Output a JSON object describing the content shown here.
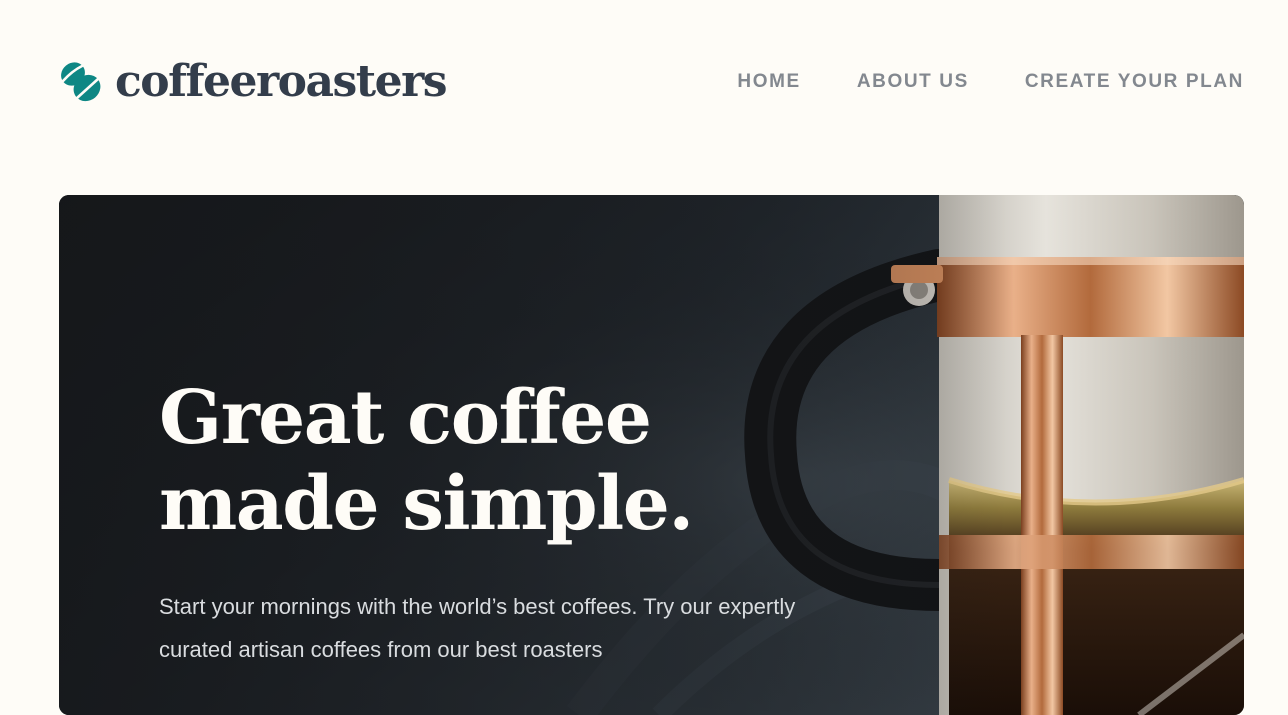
{
  "brand": {
    "logo_text": "coffeeroasters",
    "logo_icon": "coffee-beans-icon",
    "accent_color": "#0E8784",
    "dark_color": "#333D4B"
  },
  "nav": {
    "items": [
      {
        "label": "HOME"
      },
      {
        "label": "ABOUT US"
      },
      {
        "label": "CREATE YOUR PLAN"
      }
    ]
  },
  "hero": {
    "title_line1": "Great coffee",
    "title_line2": "made simple.",
    "description": "Start your mornings with the world’s best coffees. Try our expertly curated artisan coffees from our best roasters",
    "image": "french-press-photo"
  },
  "colors": {
    "page_background": "#FEFCF7",
    "nav_text": "#83888F",
    "hero_title": "#FEFCF7"
  }
}
